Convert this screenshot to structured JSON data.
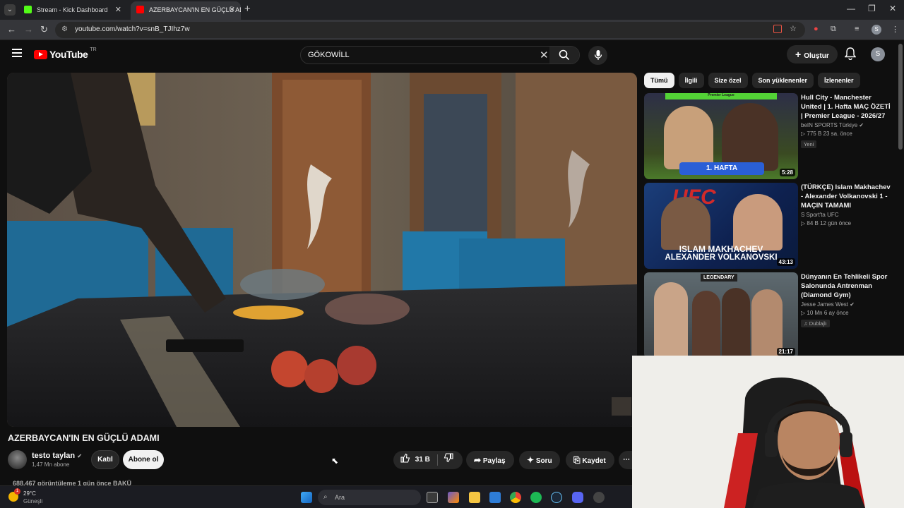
{
  "browser": {
    "tabs": [
      {
        "title": "Stream - Kick Dashboard",
        "active": false
      },
      {
        "title": "AZERBAYCAN'IN EN GÜÇLÜ AD",
        "active": true
      }
    ],
    "url": "youtube.com/watch?v=snB_TJIhz7w",
    "profile_initial": "S"
  },
  "youtube": {
    "logo_text": "YouTube",
    "country_code": "TR",
    "search_value": "GÖKOWİLL",
    "create_label": "Oluştur",
    "avatar_initial": "S"
  },
  "chips": [
    "Tümü",
    "İlgili",
    "Size özel",
    "Son yüklenenler",
    "İzlenenler"
  ],
  "recommendations": [
    {
      "title": "Hull City - Manchester United | 1. Hafta MAÇ ÖZETİ | Premier League - 2026/27",
      "channel": "beIN SPORTS Türkiye",
      "verified": true,
      "meta": "775 B  23 sa. önce",
      "badge": "Yeni",
      "duration": "5:28",
      "thumb_text": "1. HAFTA",
      "thumb_header": "Premier League"
    },
    {
      "title": "(TÜRKÇE) Islam Makhachev - Alexander Volkanovski 1 - MAÇIN TAMAMI",
      "channel": "S Sport'ta UFC",
      "verified": false,
      "meta": "84 B  12 gün önce",
      "badge": "",
      "duration": "43:13",
      "thumb_text": "ISLAM MAKHACHEV",
      "thumb_text2": "ALEXANDER VOLKANOVSKI",
      "thumb_header": "UFC"
    },
    {
      "title": "Dünyanın En Tehlikeli Spor Salonunda Antrenman (Diamond Gym)",
      "channel": "Jesse James West",
      "verified": true,
      "meta": "10 Mn  6 ay önce",
      "badge": "Dublajlı",
      "duration": "21:17",
      "thumb_header": "LEGENDARY"
    }
  ],
  "video": {
    "title": "AZERBAYCAN'IN EN GÜÇLÜ ADAMI",
    "channel": "testo taylan",
    "subscribers": "1,47 Mn abone",
    "join_label": "Katıl",
    "subscribe_label": "Abone ol",
    "likes": "31 B",
    "share_label": "Paylaş",
    "ask_label": "Soru",
    "save_label": "Kaydet",
    "views_line": "688.467 görüntüleme  1 gün önce  BAKÜ"
  },
  "taskbar": {
    "temperature": "29°C",
    "condition": "Güneşli",
    "search_placeholder": "Ara",
    "weather_badge": "1"
  },
  "colors": {
    "accent_red": "#ff0000",
    "kick_green": "#53fc18"
  }
}
